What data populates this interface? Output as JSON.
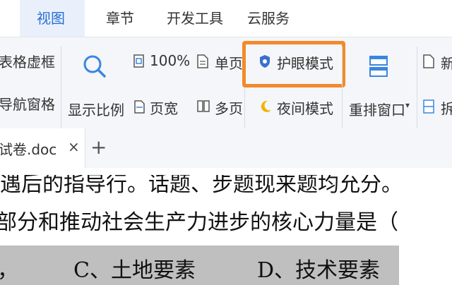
{
  "menu_tabs": {
    "view": "视图",
    "chapter": "章节",
    "devtools": "开发工具",
    "cloud": "云服务"
  },
  "ribbon": {
    "left_top": "表格虚框",
    "left_bottom": "导航窗格",
    "zoom_label": "显示比例",
    "zoom_value": "100%",
    "single_page": "单页",
    "page_width": "页宽",
    "multi_page": "多页",
    "eye_mode": "护眼模式",
    "night_mode": "夜间模式",
    "rearrange": "重排窗口",
    "new_prefix": "新",
    "split_prefix": "拆"
  },
  "doc_tab": {
    "filename": "试卷.doc",
    "close": "×",
    "add": "+"
  },
  "document": {
    "line1": "遇后的指导行。话题、步题现来题均允分。",
    "line2": "部分和推动社会生产力进步的核心力量是（",
    "option_c": "C、土地要素",
    "option_d": "D、技术要素",
    "prefix": "，"
  },
  "colors": {
    "accent": "#2b6fd6",
    "highlight": "#f28a2a",
    "gray_band": "#bfbfbf"
  }
}
